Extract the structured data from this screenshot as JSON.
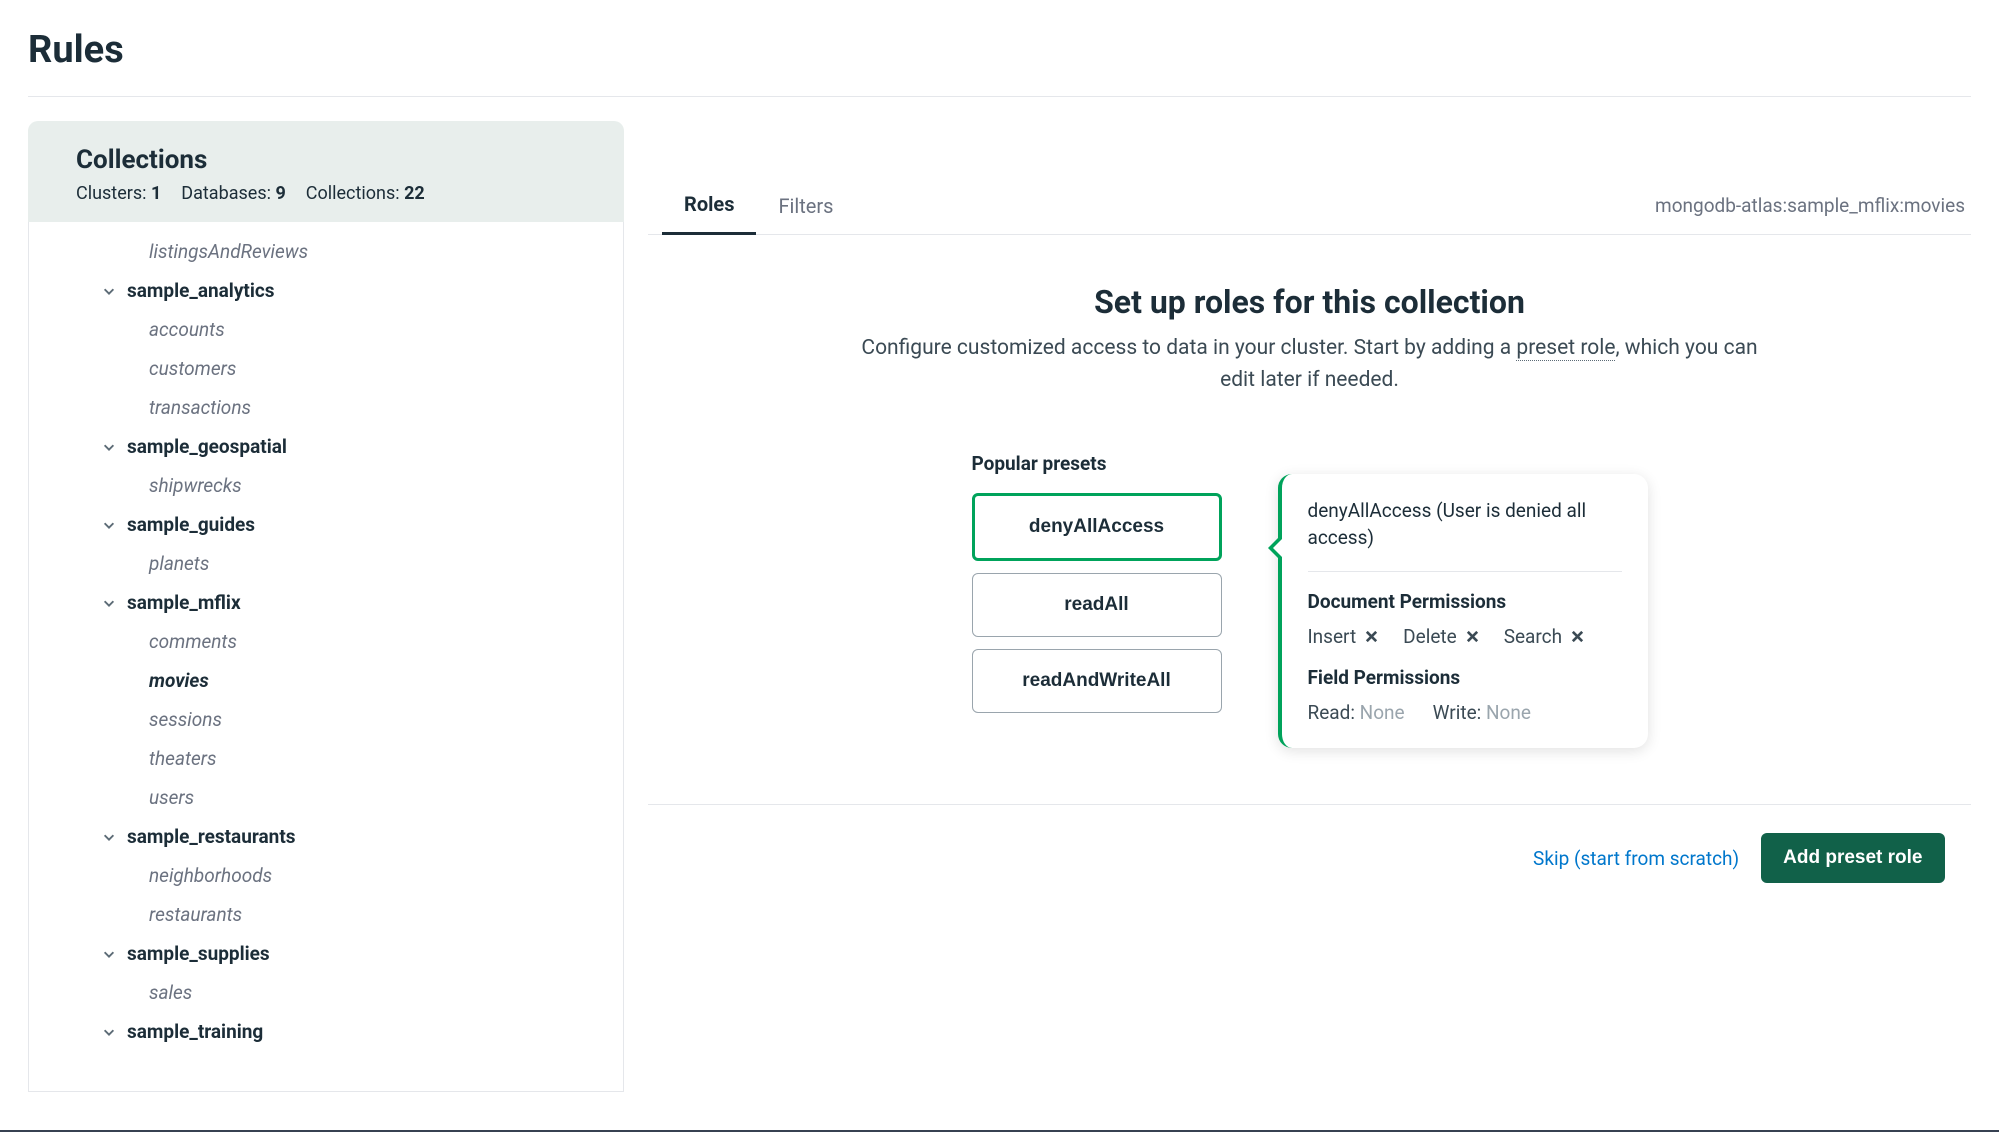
{
  "page": {
    "title": "Rules"
  },
  "sidebar": {
    "title": "Collections",
    "stats": {
      "clusters_label": "Clusters:",
      "clusters_count": "1",
      "databases_label": "Databases:",
      "databases_count": "9",
      "collections_label": "Collections:",
      "collections_count": "22"
    },
    "loose_collection": "listingsAndReviews",
    "databases": [
      {
        "name": "sample_analytics",
        "collections": [
          "accounts",
          "customers",
          "transactions"
        ]
      },
      {
        "name": "sample_geospatial",
        "collections": [
          "shipwrecks"
        ]
      },
      {
        "name": "sample_guides",
        "collections": [
          "planets"
        ]
      },
      {
        "name": "sample_mflix",
        "collections": [
          "comments",
          "movies",
          "sessions",
          "theaters",
          "users"
        ],
        "active": "movies"
      },
      {
        "name": "sample_restaurants",
        "collections": [
          "neighborhoods",
          "restaurants"
        ]
      },
      {
        "name": "sample_supplies",
        "collections": [
          "sales"
        ]
      },
      {
        "name": "sample_training",
        "collections": []
      }
    ]
  },
  "tabs": {
    "roles": "Roles",
    "filters": "Filters"
  },
  "breadcrumb": "mongodb-atlas:sample_mflix:movies",
  "setup": {
    "title": "Set up roles for this collection",
    "subtitle_pre": "Configure customized access to data in your cluster. Start by adding a ",
    "subtitle_link": "preset role",
    "subtitle_post": ", which you can edit later if needed."
  },
  "presets": {
    "heading": "Popular presets",
    "options": [
      "denyAllAccess",
      "readAll",
      "readAndWriteAll"
    ],
    "selected": 0
  },
  "detail": {
    "description": "denyAllAccess (User is denied all access)",
    "doc_perm_title": "Document Permissions",
    "doc_perms": [
      "Insert",
      "Delete",
      "Search"
    ],
    "field_perm_title": "Field Permissions",
    "read_label": "Read",
    "read_value": "None",
    "write_label": "Write",
    "write_value": "None"
  },
  "actions": {
    "skip": "Skip (start from scratch)",
    "add": "Add preset role"
  }
}
